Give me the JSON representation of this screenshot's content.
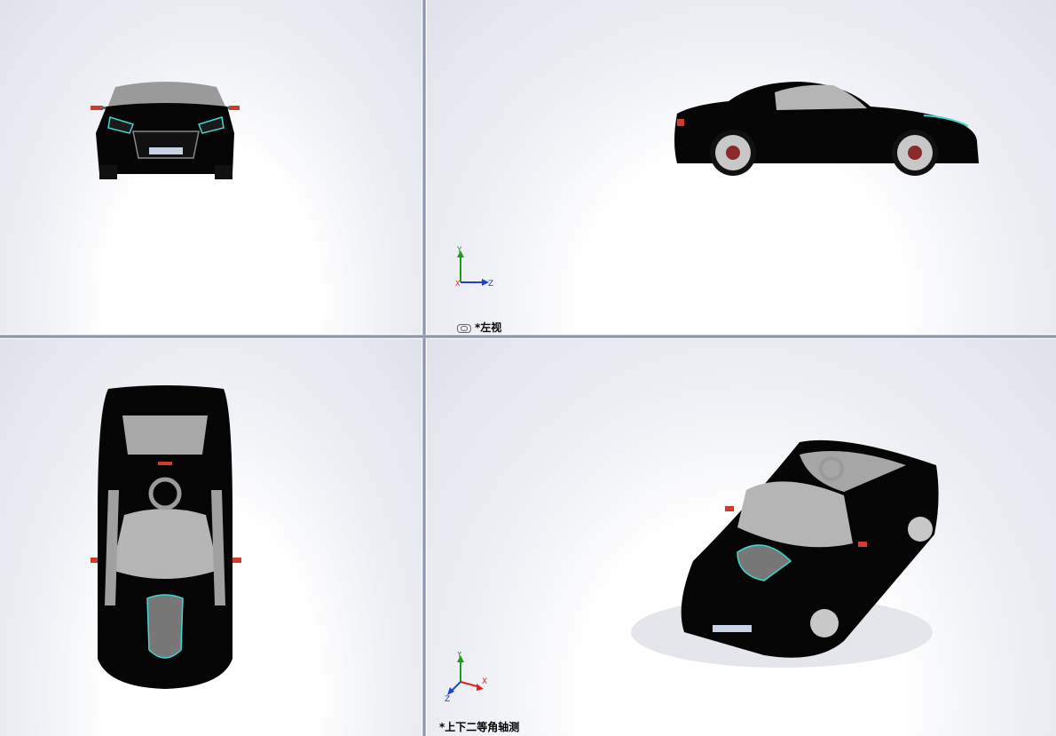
{
  "views": {
    "left": {
      "label": "*左视",
      "axes": {
        "up": "Y",
        "right": "Z",
        "center": "X"
      }
    },
    "isometric": {
      "label": "*上下二等角轴测",
      "axes": {
        "up": "Y",
        "right": "X",
        "left": "Z"
      }
    }
  },
  "colors": {
    "body": "#050505",
    "glass": "#b5b5b5",
    "accent_cyan": "#3fd8d0",
    "mirror_red": "#d23a2a",
    "rim": "#c8c8c8",
    "axis_x": "#e02020",
    "axis_y": "#1f9a1f",
    "axis_z": "#2040d0"
  },
  "icons": [
    "link-icon",
    "coordinate-triad-icon"
  ]
}
